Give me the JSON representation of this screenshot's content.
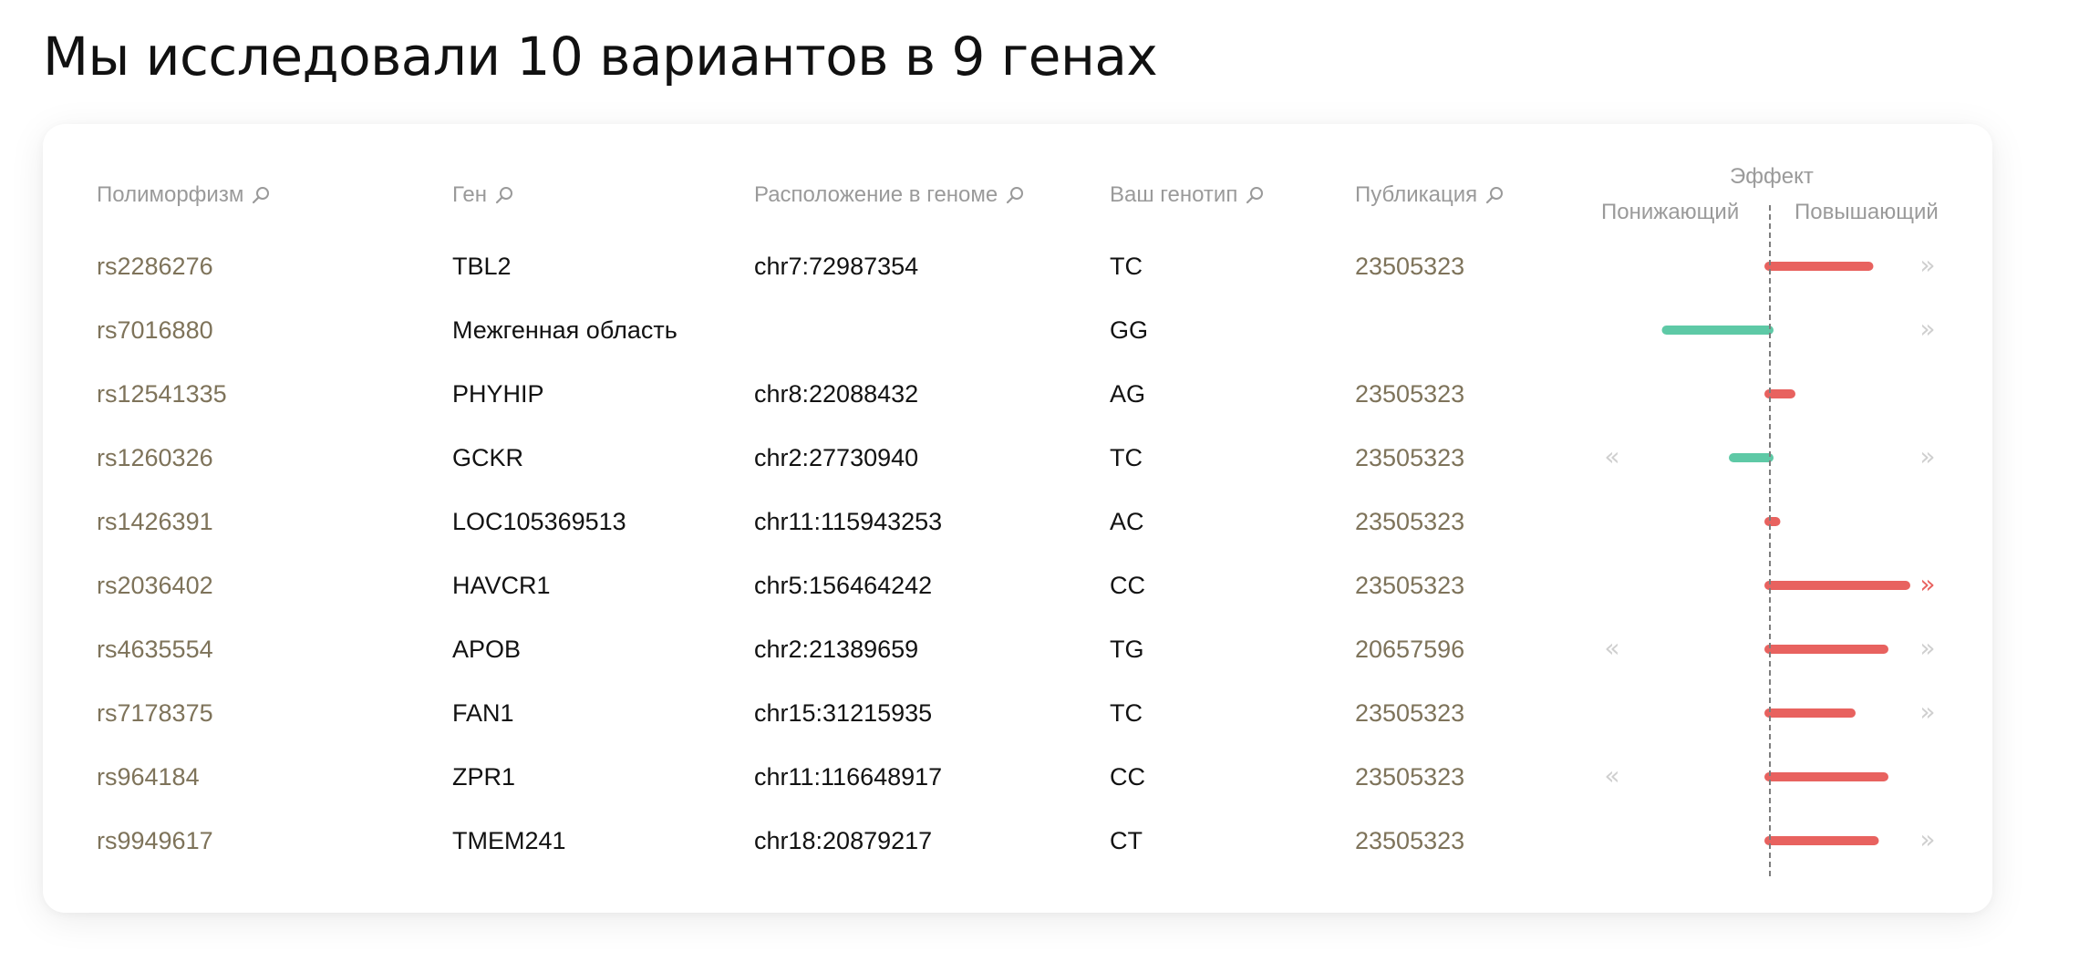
{
  "title": "Мы исследовали 10 вариантов в 9 генах",
  "columns": {
    "snp": "Полиморфизм",
    "gene": "Ген",
    "location": "Расположение в геноме",
    "genotype": "Ваш генотип",
    "publication": "Публикация"
  },
  "effect": {
    "title": "Эффект",
    "low_label": "Понижающий",
    "high_label": "Повышающий",
    "scale_min": -1,
    "scale_max": 1
  },
  "colors": {
    "decrease": "#5ec9a6",
    "increase": "#e8625f",
    "track": "#d8d8d8",
    "link": "#7e735a"
  },
  "rows": [
    {
      "snp": "rs2286276",
      "gene": "TBL2",
      "location": "chr7:72987354",
      "genotype": "TC",
      "publication": "23505323",
      "range_low": -0.62,
      "range_high": 1.0,
      "effect": 0.73,
      "overflow_low": false,
      "overflow_high": true,
      "overflow_high_active": false
    },
    {
      "snp": "rs7016880",
      "gene": "Межгенная область",
      "location": "",
      "genotype": "GG",
      "publication": "",
      "range_low": -0.75,
      "range_high": 1.0,
      "effect": -0.75,
      "overflow_low": false,
      "overflow_high": true,
      "overflow_high_active": false
    },
    {
      "snp": "rs12541335",
      "gene": "PHYHIP",
      "location": "chr8:22088432",
      "genotype": "AG",
      "publication": "23505323",
      "range_low": -0.67,
      "range_high": 1.0,
      "effect": 0.16,
      "overflow_low": false,
      "overflow_high": false,
      "overflow_high_active": false
    },
    {
      "snp": "rs1260326",
      "gene": "GCKR",
      "location": "chr2:27730940",
      "genotype": "TC",
      "publication": "23505323",
      "range_low": -1.0,
      "range_high": 1.0,
      "effect": -0.26,
      "overflow_low": true,
      "overflow_high": true,
      "overflow_high_active": false
    },
    {
      "snp": "rs1426391",
      "gene": "LOC105369513",
      "location": "chr11:115943253",
      "genotype": "AC",
      "publication": "23505323",
      "range_low": -0.84,
      "range_high": 0.96,
      "effect": 0.05,
      "overflow_low": false,
      "overflow_high": false,
      "overflow_high_active": false
    },
    {
      "snp": "rs2036402",
      "gene": "HAVCR1",
      "location": "chr5:156464242",
      "genotype": "CC",
      "publication": "23505323",
      "range_low": -0.37,
      "range_high": 1.0,
      "effect": 1.0,
      "overflow_low": false,
      "overflow_high": true,
      "overflow_high_active": true
    },
    {
      "snp": "rs4635554",
      "gene": "APOB",
      "location": "chr2:21389659",
      "genotype": "TG",
      "publication": "20657596",
      "range_low": -1.0,
      "range_high": 1.0,
      "effect": 0.84,
      "overflow_low": true,
      "overflow_high": true,
      "overflow_high_active": false
    },
    {
      "snp": "rs7178375",
      "gene": "FAN1",
      "location": "chr15:31215935",
      "genotype": "TC",
      "publication": "23505323",
      "range_low": -0.37,
      "range_high": 1.0,
      "effect": 0.6,
      "overflow_low": false,
      "overflow_high": true,
      "overflow_high_active": false
    },
    {
      "snp": "rs964184",
      "gene": "ZPR1",
      "location": "chr11:116648917",
      "genotype": "CC",
      "publication": "23505323",
      "range_low": -1.0,
      "range_high": 0.9,
      "effect": 0.84,
      "overflow_low": true,
      "overflow_high": false,
      "overflow_high_active": false
    },
    {
      "snp": "rs9949617",
      "gene": "TMEM241",
      "location": "chr18:20879217",
      "genotype": "CT",
      "publication": "23505323",
      "range_low": -0.22,
      "range_high": 1.0,
      "effect": 0.77,
      "overflow_low": false,
      "overflow_high": true,
      "overflow_high_active": false
    }
  ]
}
